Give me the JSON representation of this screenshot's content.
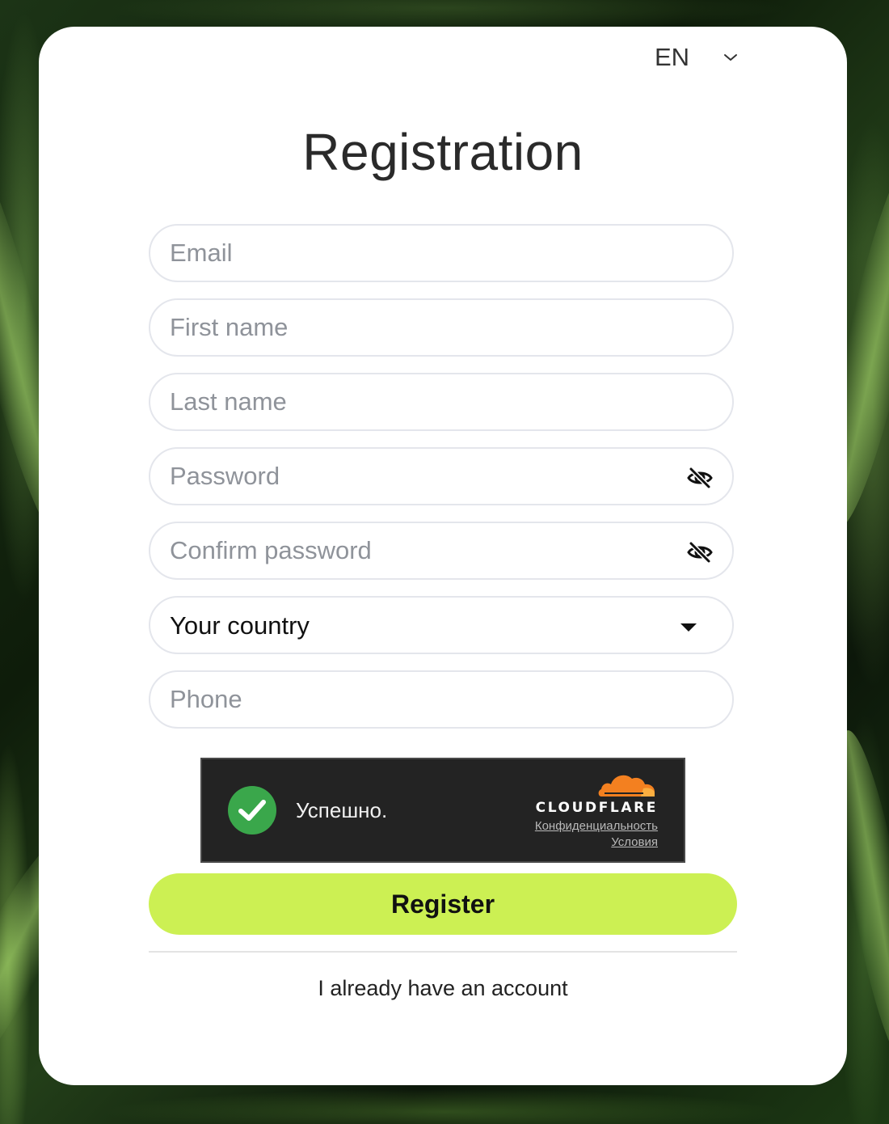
{
  "language": {
    "selected": "EN"
  },
  "form": {
    "title": "Registration",
    "fields": {
      "email_placeholder": "Email",
      "first_name_placeholder": "First name",
      "last_name_placeholder": "Last name",
      "password_placeholder": "Password",
      "confirm_password_placeholder": "Confirm password",
      "country_label": "Your country",
      "phone_placeholder": "Phone"
    },
    "register_label": "Register",
    "login_link": "I already have an account"
  },
  "captcha": {
    "status": "Успешно.",
    "brand": "CLOUDFLARE",
    "privacy_link": "Конфиденциальность",
    "terms_link": "Условия"
  },
  "colors": {
    "accent": "#ccf053",
    "captcha_bg": "#232323",
    "success": "#3aa74b",
    "cloudflare_orange": "#f38020"
  },
  "icons": {
    "language_chevron": "chevron-down-icon",
    "password_toggle": "eye-off-icon",
    "country_dropdown": "caret-down-icon",
    "captcha_success": "check-circle-icon",
    "captcha_brand": "cloudflare-cloud-icon"
  }
}
